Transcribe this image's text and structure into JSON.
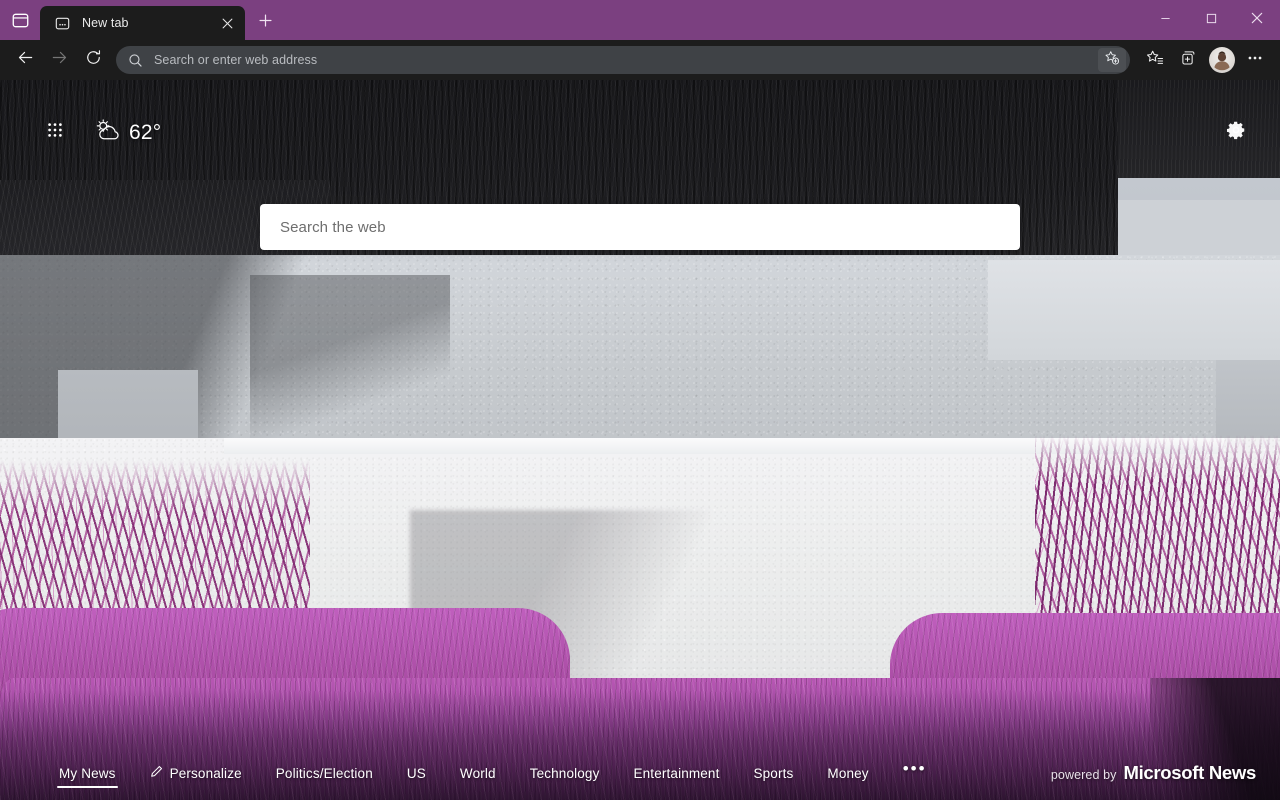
{
  "window": {
    "titlebar": {
      "tab_actions_icon": "tab-actions-window-icon",
      "tab_actions_tooltip": "Tab actions menu",
      "new_tab_icon": "plus-icon",
      "new_tab_tooltip": "New tab",
      "tabs": [
        {
          "title": "New tab",
          "favicon": "new-tab-page-icon",
          "close_icon": "close-icon",
          "active": true
        }
      ]
    },
    "caption": {
      "minimize_icon": "minimize-icon",
      "maximize_icon": "maximize-icon",
      "close_icon": "close-icon"
    },
    "accent_color": "#7b4080",
    "toolbar_color": "#1c1c1c",
    "omnibox_color": "#3f4246"
  },
  "toolbar": {
    "back_icon": "back-arrow-icon",
    "forward_icon": "forward-arrow-icon",
    "refresh_icon": "refresh-icon",
    "omnibox": {
      "search_icon": "search-icon",
      "placeholder": "Search or enter web address",
      "value": "",
      "add_favorite_icon": "add-favorite-star-icon"
    },
    "favorites_icon": "favorites-star-list-icon",
    "collections_icon": "collections-icon",
    "profile_icon": "profile-avatar",
    "settings_icon": "more-ellipsis-icon"
  },
  "newtab": {
    "apps_icon": "app-grid-icon",
    "weather": {
      "condition_icon": "partly-cloudy-day-icon",
      "temperature": "62°"
    },
    "settings_icon": "page-settings-gear-icon",
    "search": {
      "placeholder": "Search the web",
      "value": ""
    },
    "news_nav": {
      "items": [
        {
          "label": "My News",
          "active": true,
          "icon": null
        },
        {
          "label": "Personalize",
          "active": false,
          "icon": "pencil-icon"
        },
        {
          "label": "Politics/Election",
          "active": false,
          "icon": null
        },
        {
          "label": "US",
          "active": false,
          "icon": null
        },
        {
          "label": "World",
          "active": false,
          "icon": null
        },
        {
          "label": "Technology",
          "active": false,
          "icon": null
        },
        {
          "label": "Entertainment",
          "active": false,
          "icon": null
        },
        {
          "label": "Sports",
          "active": false,
          "icon": null
        },
        {
          "label": "Money",
          "active": false,
          "icon": null
        }
      ],
      "more_label": "•••"
    },
    "footer": {
      "powered_label": "powered by",
      "brand": "Microsoft News"
    }
  }
}
